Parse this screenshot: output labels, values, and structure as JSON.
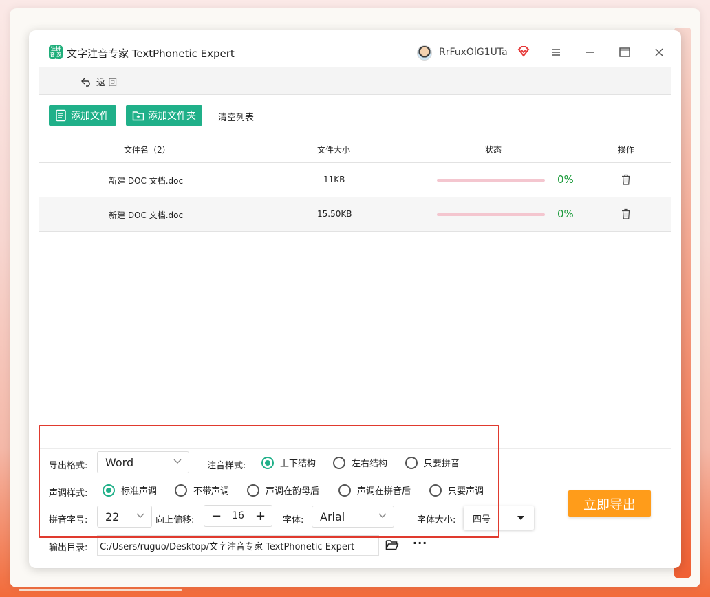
{
  "app": {
    "logo_text": "注拼音 汉字",
    "title": "文字注音专家 TextPhonetic Expert",
    "username": "RrFuxOlG1UTa"
  },
  "nav": {
    "back_label": "返 回"
  },
  "toolbar": {
    "add_file": "添加文件",
    "add_folder": "添加文件夹",
    "clear_list": "清空列表"
  },
  "table": {
    "headers": {
      "name": "文件名（2）",
      "size": "文件大小",
      "status": "状态",
      "action": "操作"
    },
    "rows": [
      {
        "name": "新建 DOC 文档.doc",
        "size": "11KB",
        "progress": 0,
        "percent": "0%"
      },
      {
        "name": "新建 DOC 文档.doc",
        "size": "15.50KB",
        "progress": 0,
        "percent": "0%"
      }
    ]
  },
  "settings": {
    "export_format_label": "导出格式:",
    "export_format_value": "Word",
    "phonetic_style_label": "注音样式:",
    "phonetic_options": [
      "上下结构",
      "左右结构",
      "只要拼音"
    ],
    "phonetic_selected": 0,
    "tone_style_label": "声调样式:",
    "tone_options": [
      "标准声调",
      "不带声调",
      "声调在韵母后",
      "声调在拼音后",
      "只要声调"
    ],
    "tone_selected": 0,
    "pinyin_size_label": "拼音字号:",
    "pinyin_size_value": "22",
    "offset_label": "向上偏移:",
    "offset_value": "16",
    "font_label": "字体:",
    "font_value": "Arial",
    "font_size_label": "字体大小:",
    "font_size_value": "四号",
    "output_dir_label": "输出目录:",
    "output_dir_value": "C:/Users/ruguo/Desktop/文字注音专家 TextPhonetic Expert",
    "more_label": "···"
  },
  "actions": {
    "export_now": "立即导出"
  },
  "colors": {
    "accent": "#20b089",
    "export": "#ff9c1a",
    "highlight_frame": "#e03a2e",
    "percent": "#1a9a3a"
  }
}
